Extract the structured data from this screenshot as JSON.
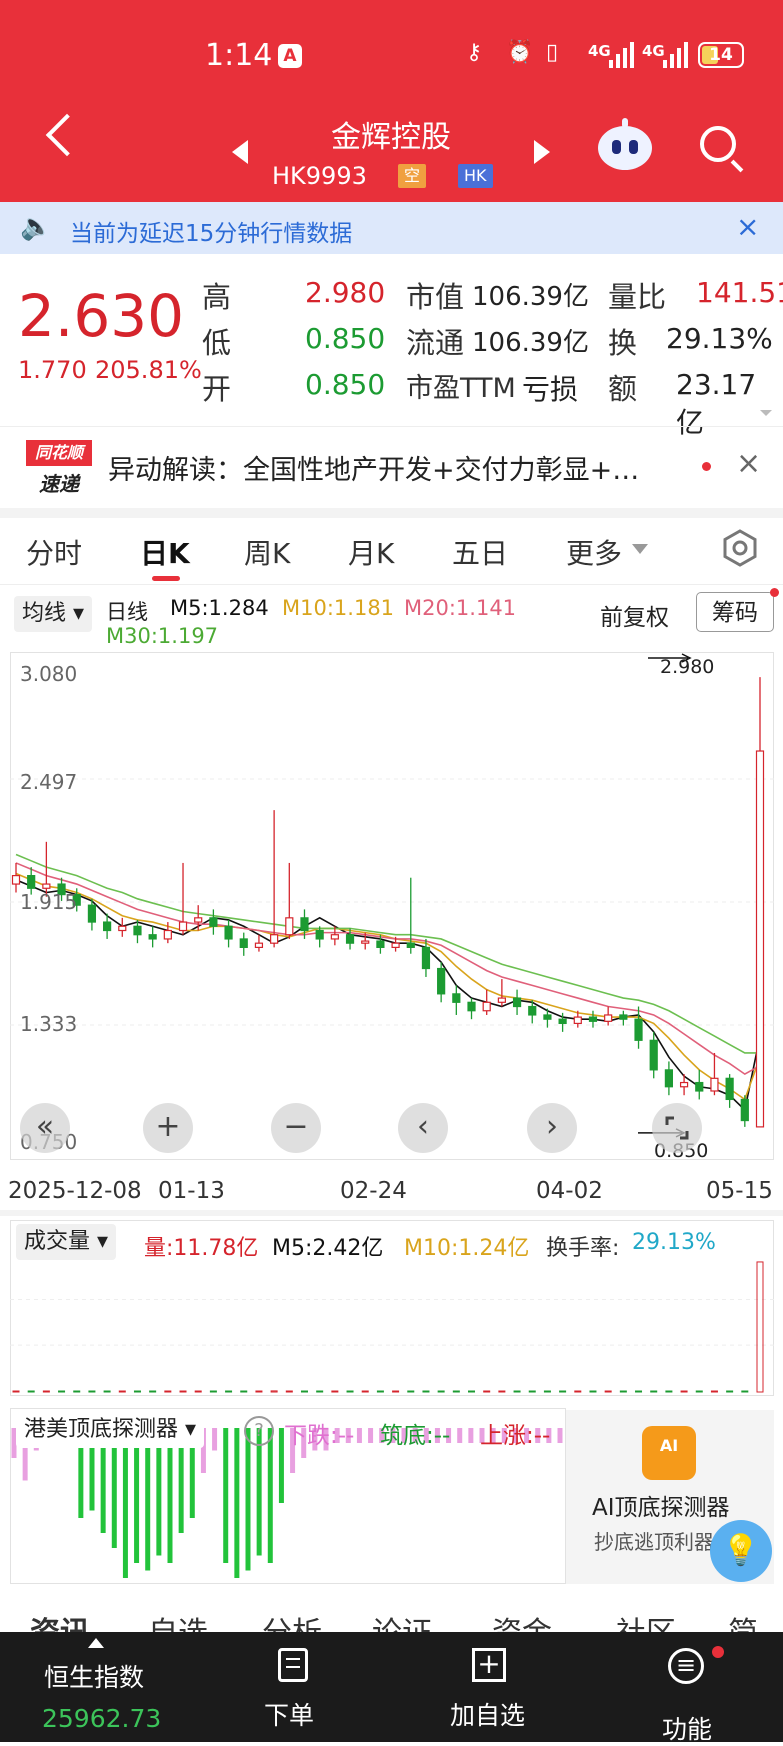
{
  "status_bar": {
    "time": "1:14",
    "a_badge": "A",
    "network": "4G",
    "battery": "14"
  },
  "header": {
    "title": "金辉控股",
    "code": "HK9993",
    "tag_short": "空",
    "tag_market": "HK"
  },
  "notice": {
    "text": "当前为延迟15分钟行情数据"
  },
  "quote": {
    "price": "2.630",
    "change": "1.770",
    "change_pct": "205.81%",
    "rows": [
      {
        "label1": "高",
        "value1": "2.980",
        "label2": "市值",
        "value2": "106.39亿",
        "label3": "量比",
        "value3": "141.51"
      },
      {
        "label1": "低",
        "value1": "0.850",
        "label2": "流通",
        "value2": "106.39亿",
        "label3": "换",
        "value3": "29.13%"
      },
      {
        "label1": "开",
        "value1": "0.850",
        "label2": "市盈TTM",
        "value2": "亏损",
        "label3": "额",
        "value3": "23.17亿"
      }
    ]
  },
  "news": {
    "logo_top": "同花顺",
    "logo_bottom": "速递",
    "text": "异动解读：全国性地产开发+交付力彰显+…"
  },
  "tabs": [
    "分时",
    "日K",
    "周K",
    "月K",
    "五日",
    "更多"
  ],
  "legend": {
    "ma_toggle": "均线",
    "period": "日线",
    "m5": "M5:1.284",
    "m10": "M10:1.181",
    "m20": "M20:1.141",
    "m30": "M30:1.197",
    "adjust": "前复权",
    "chip_button": "筹码"
  },
  "colors": {
    "up": "#d5242c",
    "down": "#1c9b32",
    "m5": "#111111",
    "m10": "#d9a41c",
    "m20": "#e0607a",
    "m30": "#6cbf50",
    "header": "#e8303a"
  },
  "chart_data": [
    {
      "type": "candlestick",
      "y_ticks": [
        "3.080",
        "2.497",
        "1.915",
        "1.333",
        "0.750"
      ],
      "ylim": [
        0.75,
        3.08
      ],
      "x_ticks": [
        "2025-12-08",
        "01-13",
        "02-24",
        "04-02",
        "05-15"
      ],
      "high_label": "2.980",
      "low_label": "0.850",
      "series": [
        {
          "name": "M5",
          "values": [
            2.02,
            1.99,
            1.96,
            1.97,
            1.95,
            1.92,
            1.85,
            1.8,
            1.82,
            1.8,
            1.78,
            1.76,
            1.8,
            1.84,
            1.83,
            1.8,
            1.76,
            1.72,
            1.75,
            1.8,
            1.84,
            1.8,
            1.76,
            1.75,
            1.74,
            1.72,
            1.72,
            1.7,
            1.63,
            1.52,
            1.46,
            1.44,
            1.42,
            1.45,
            1.44,
            1.4,
            1.37,
            1.36,
            1.36,
            1.35,
            1.37,
            1.38,
            1.3,
            1.18,
            1.09,
            1.04,
            1.03,
            1.0,
            0.93,
            1.28
          ]
        },
        {
          "name": "M10",
          "values": [
            2.05,
            2.02,
            1.99,
            1.98,
            1.96,
            1.93,
            1.89,
            1.85,
            1.83,
            1.82,
            1.8,
            1.78,
            1.78,
            1.8,
            1.8,
            1.79,
            1.78,
            1.76,
            1.75,
            1.77,
            1.79,
            1.79,
            1.78,
            1.77,
            1.76,
            1.74,
            1.73,
            1.72,
            1.68,
            1.61,
            1.55,
            1.5,
            1.47,
            1.46,
            1.45,
            1.43,
            1.41,
            1.39,
            1.38,
            1.37,
            1.37,
            1.37,
            1.34,
            1.27,
            1.19,
            1.12,
            1.07,
            1.03,
            0.98,
            1.18
          ]
        },
        {
          "name": "M20",
          "values": [
            2.1,
            2.07,
            2.04,
            2.02,
            2.0,
            1.97,
            1.94,
            1.91,
            1.88,
            1.86,
            1.84,
            1.82,
            1.81,
            1.81,
            1.8,
            1.79,
            1.78,
            1.77,
            1.76,
            1.76,
            1.77,
            1.77,
            1.77,
            1.76,
            1.75,
            1.74,
            1.74,
            1.73,
            1.71,
            1.67,
            1.63,
            1.59,
            1.56,
            1.54,
            1.52,
            1.5,
            1.48,
            1.46,
            1.44,
            1.42,
            1.41,
            1.4,
            1.38,
            1.34,
            1.29,
            1.24,
            1.19,
            1.15,
            1.1,
            1.14
          ]
        },
        {
          "name": "M30",
          "values": [
            2.14,
            2.11,
            2.08,
            2.06,
            2.04,
            2.01,
            1.98,
            1.96,
            1.93,
            1.91,
            1.89,
            1.87,
            1.86,
            1.85,
            1.84,
            1.83,
            1.82,
            1.81,
            1.8,
            1.79,
            1.79,
            1.79,
            1.79,
            1.78,
            1.77,
            1.76,
            1.76,
            1.75,
            1.74,
            1.71,
            1.68,
            1.65,
            1.62,
            1.6,
            1.58,
            1.56,
            1.54,
            1.52,
            1.5,
            1.48,
            1.46,
            1.45,
            1.43,
            1.4,
            1.36,
            1.32,
            1.28,
            1.24,
            1.2,
            1.2
          ]
        }
      ],
      "candles": [
        [
          2.0,
          2.04,
          2.1,
          1.96
        ],
        [
          2.04,
          1.98,
          2.08,
          1.95
        ],
        [
          1.98,
          2.0,
          2.2,
          1.94
        ],
        [
          2.0,
          1.95,
          2.03,
          1.92
        ],
        [
          1.95,
          1.9,
          1.98,
          1.87
        ],
        [
          1.9,
          1.82,
          1.93,
          1.78
        ],
        [
          1.82,
          1.78,
          1.86,
          1.74
        ],
        [
          1.78,
          1.8,
          1.84,
          1.75
        ],
        [
          1.8,
          1.76,
          1.83,
          1.72
        ],
        [
          1.76,
          1.74,
          1.8,
          1.7
        ],
        [
          1.74,
          1.78,
          1.82,
          1.72
        ],
        [
          1.78,
          1.82,
          2.1,
          1.76
        ],
        [
          1.82,
          1.84,
          1.9,
          1.78
        ],
        [
          1.84,
          1.8,
          1.88,
          1.76
        ],
        [
          1.8,
          1.74,
          1.83,
          1.7
        ],
        [
          1.74,
          1.7,
          1.77,
          1.66
        ],
        [
          1.7,
          1.72,
          1.76,
          1.68
        ],
        [
          1.72,
          1.76,
          2.35,
          1.7
        ],
        [
          1.76,
          1.84,
          2.1,
          1.74
        ],
        [
          1.84,
          1.78,
          1.88,
          1.74
        ],
        [
          1.78,
          1.74,
          1.8,
          1.7
        ],
        [
          1.74,
          1.76,
          1.8,
          1.71
        ],
        [
          1.76,
          1.72,
          1.79,
          1.69
        ],
        [
          1.72,
          1.73,
          1.77,
          1.69
        ],
        [
          1.73,
          1.7,
          1.76,
          1.67
        ],
        [
          1.7,
          1.72,
          1.75,
          1.68
        ],
        [
          1.72,
          1.7,
          2.03,
          1.67
        ],
        [
          1.7,
          1.6,
          1.74,
          1.56
        ],
        [
          1.6,
          1.48,
          1.63,
          1.44
        ],
        [
          1.48,
          1.44,
          1.52,
          1.38
        ],
        [
          1.44,
          1.4,
          1.46,
          1.36
        ],
        [
          1.4,
          1.44,
          1.5,
          1.38
        ],
        [
          1.44,
          1.46,
          1.55,
          1.42
        ],
        [
          1.46,
          1.42,
          1.5,
          1.38
        ],
        [
          1.42,
          1.38,
          1.45,
          1.34
        ],
        [
          1.38,
          1.36,
          1.41,
          1.32
        ],
        [
          1.36,
          1.34,
          1.39,
          1.3
        ],
        [
          1.34,
          1.37,
          1.4,
          1.32
        ],
        [
          1.37,
          1.35,
          1.4,
          1.32
        ],
        [
          1.35,
          1.38,
          1.42,
          1.33
        ],
        [
          1.38,
          1.36,
          1.4,
          1.33
        ],
        [
          1.36,
          1.26,
          1.42,
          1.22
        ],
        [
          1.26,
          1.12,
          1.3,
          1.08
        ],
        [
          1.12,
          1.04,
          1.16,
          1.0
        ],
        [
          1.04,
          1.06,
          1.1,
          1.0
        ],
        [
          1.06,
          1.02,
          1.12,
          0.98
        ],
        [
          1.02,
          1.08,
          1.2,
          1.0
        ],
        [
          1.08,
          0.98,
          1.1,
          0.94
        ],
        [
          0.98,
          0.88,
          1.0,
          0.85
        ],
        [
          0.85,
          2.63,
          2.98,
          0.85
        ]
      ]
    },
    {
      "type": "bar",
      "name": "成交量",
      "values": [
        0.02,
        0.02,
        0.03,
        0.02,
        0.02,
        0.02,
        0.03,
        0.02,
        0.02,
        0.02,
        0.02,
        0.04,
        0.03,
        0.02,
        0.02,
        0.02,
        0.02,
        0.1,
        0.05,
        0.03,
        0.02,
        0.02,
        0.02,
        0.02,
        0.02,
        0.02,
        0.08,
        0.03,
        0.04,
        0.03,
        0.02,
        0.03,
        0.03,
        0.02,
        0.02,
        0.02,
        0.02,
        0.02,
        0.02,
        0.02,
        0.02,
        0.06,
        0.04,
        0.03,
        0.02,
        0.02,
        0.03,
        0.02,
        0.04,
        11.78
      ],
      "ylim": [
        0,
        12.5
      ]
    },
    {
      "type": "bar",
      "name": "港美顶底探测器",
      "values": [
        -0.2,
        -0.35,
        -0.15,
        -0.1,
        -0.1,
        -0.1,
        -0.6,
        -0.55,
        -0.7,
        -0.8,
        -1.0,
        -0.9,
        -0.95,
        -0.85,
        -0.9,
        -0.7,
        -0.6,
        -0.3,
        -0.15,
        -0.9,
        -1.0,
        -0.95,
        -0.85,
        -0.9,
        -0.5,
        -0.3,
        -0.2,
        -0.15,
        -0.15,
        -0.1,
        -0.1,
        -0.1,
        -0.1,
        -0.1,
        -0.1,
        -0.1,
        -0.1,
        -0.1,
        -0.1,
        -0.1,
        -0.1,
        -0.1,
        -0.1,
        -0.1,
        -0.1,
        -0.1,
        -0.1,
        -0.1,
        -0.1,
        -0.1
      ],
      "ylim": [
        -1.0,
        0.1
      ]
    }
  ],
  "ctrl_buttons": [
    "«",
    "+",
    "−",
    "‹",
    "›"
  ],
  "volume": {
    "label": "成交量",
    "vol": "量:11.78亿",
    "m5": "M5:2.42亿",
    "m10": "M10:1.24亿",
    "turnover_label": "换手率:",
    "turnover_value": "29.13%"
  },
  "indicator": {
    "label": "港美顶底探测器",
    "help": "?",
    "down": "下跌:--",
    "bottom": "筑底:--",
    "up": "上涨:--"
  },
  "ai_card": {
    "icon": "AI",
    "title": "AI顶底探测器",
    "subtitle": "抄底逃顶利器"
  },
  "bottom_tabs_partial": [
    "资讯",
    "自选",
    "分析",
    "论证",
    "资金",
    "社区",
    "简况"
  ],
  "bottom_bar": {
    "index_name": "恒生指数",
    "index_value": "25962.73",
    "order": "下单",
    "add_watch": "加自选",
    "functions": "功能"
  }
}
